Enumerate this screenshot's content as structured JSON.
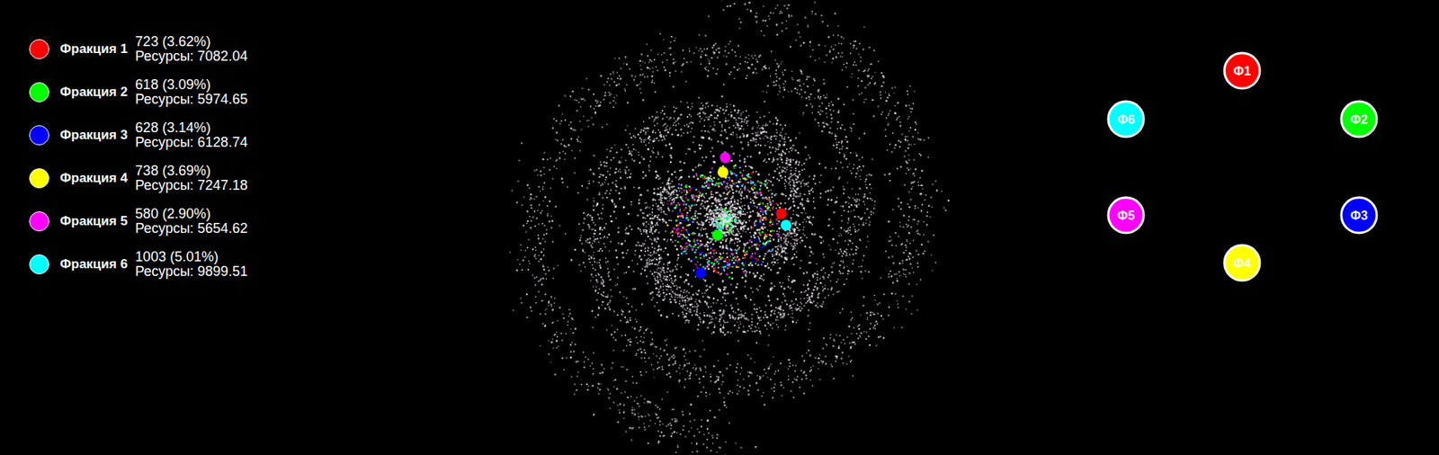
{
  "factions": [
    {
      "name": "Фракция 1",
      "count": "723 (3.62%)",
      "resources": "Ресурсы: 7082.04",
      "color": "#ff0000",
      "label": "Ф1"
    },
    {
      "name": "Фракция 2",
      "count": "618 (3.09%)",
      "resources": "Ресурсы: 5974.65",
      "color": "#00ff00",
      "label": "Ф2"
    },
    {
      "name": "Фракция 3",
      "count": "628 (3.14%)",
      "resources": "Ресурсы: 6128.74",
      "color": "#0000ff",
      "label": "Ф3"
    },
    {
      "name": "Фракция 4",
      "count": "738 (3.69%)",
      "resources": "Ресурсы: 7247.18",
      "color": "#ffff00",
      "label": "Ф4"
    },
    {
      "name": "Фракция 5",
      "count": "580 (2.90%)",
      "resources": "Ресурсы: 5654.62",
      "color": "#ff00ff",
      "label": "Ф5"
    },
    {
      "name": "Фракция 6",
      "count": "1003 (5.01%)",
      "resources": "Ресурсы: 9899.51",
      "color": "#00ffff",
      "label": "Ф6"
    }
  ]
}
